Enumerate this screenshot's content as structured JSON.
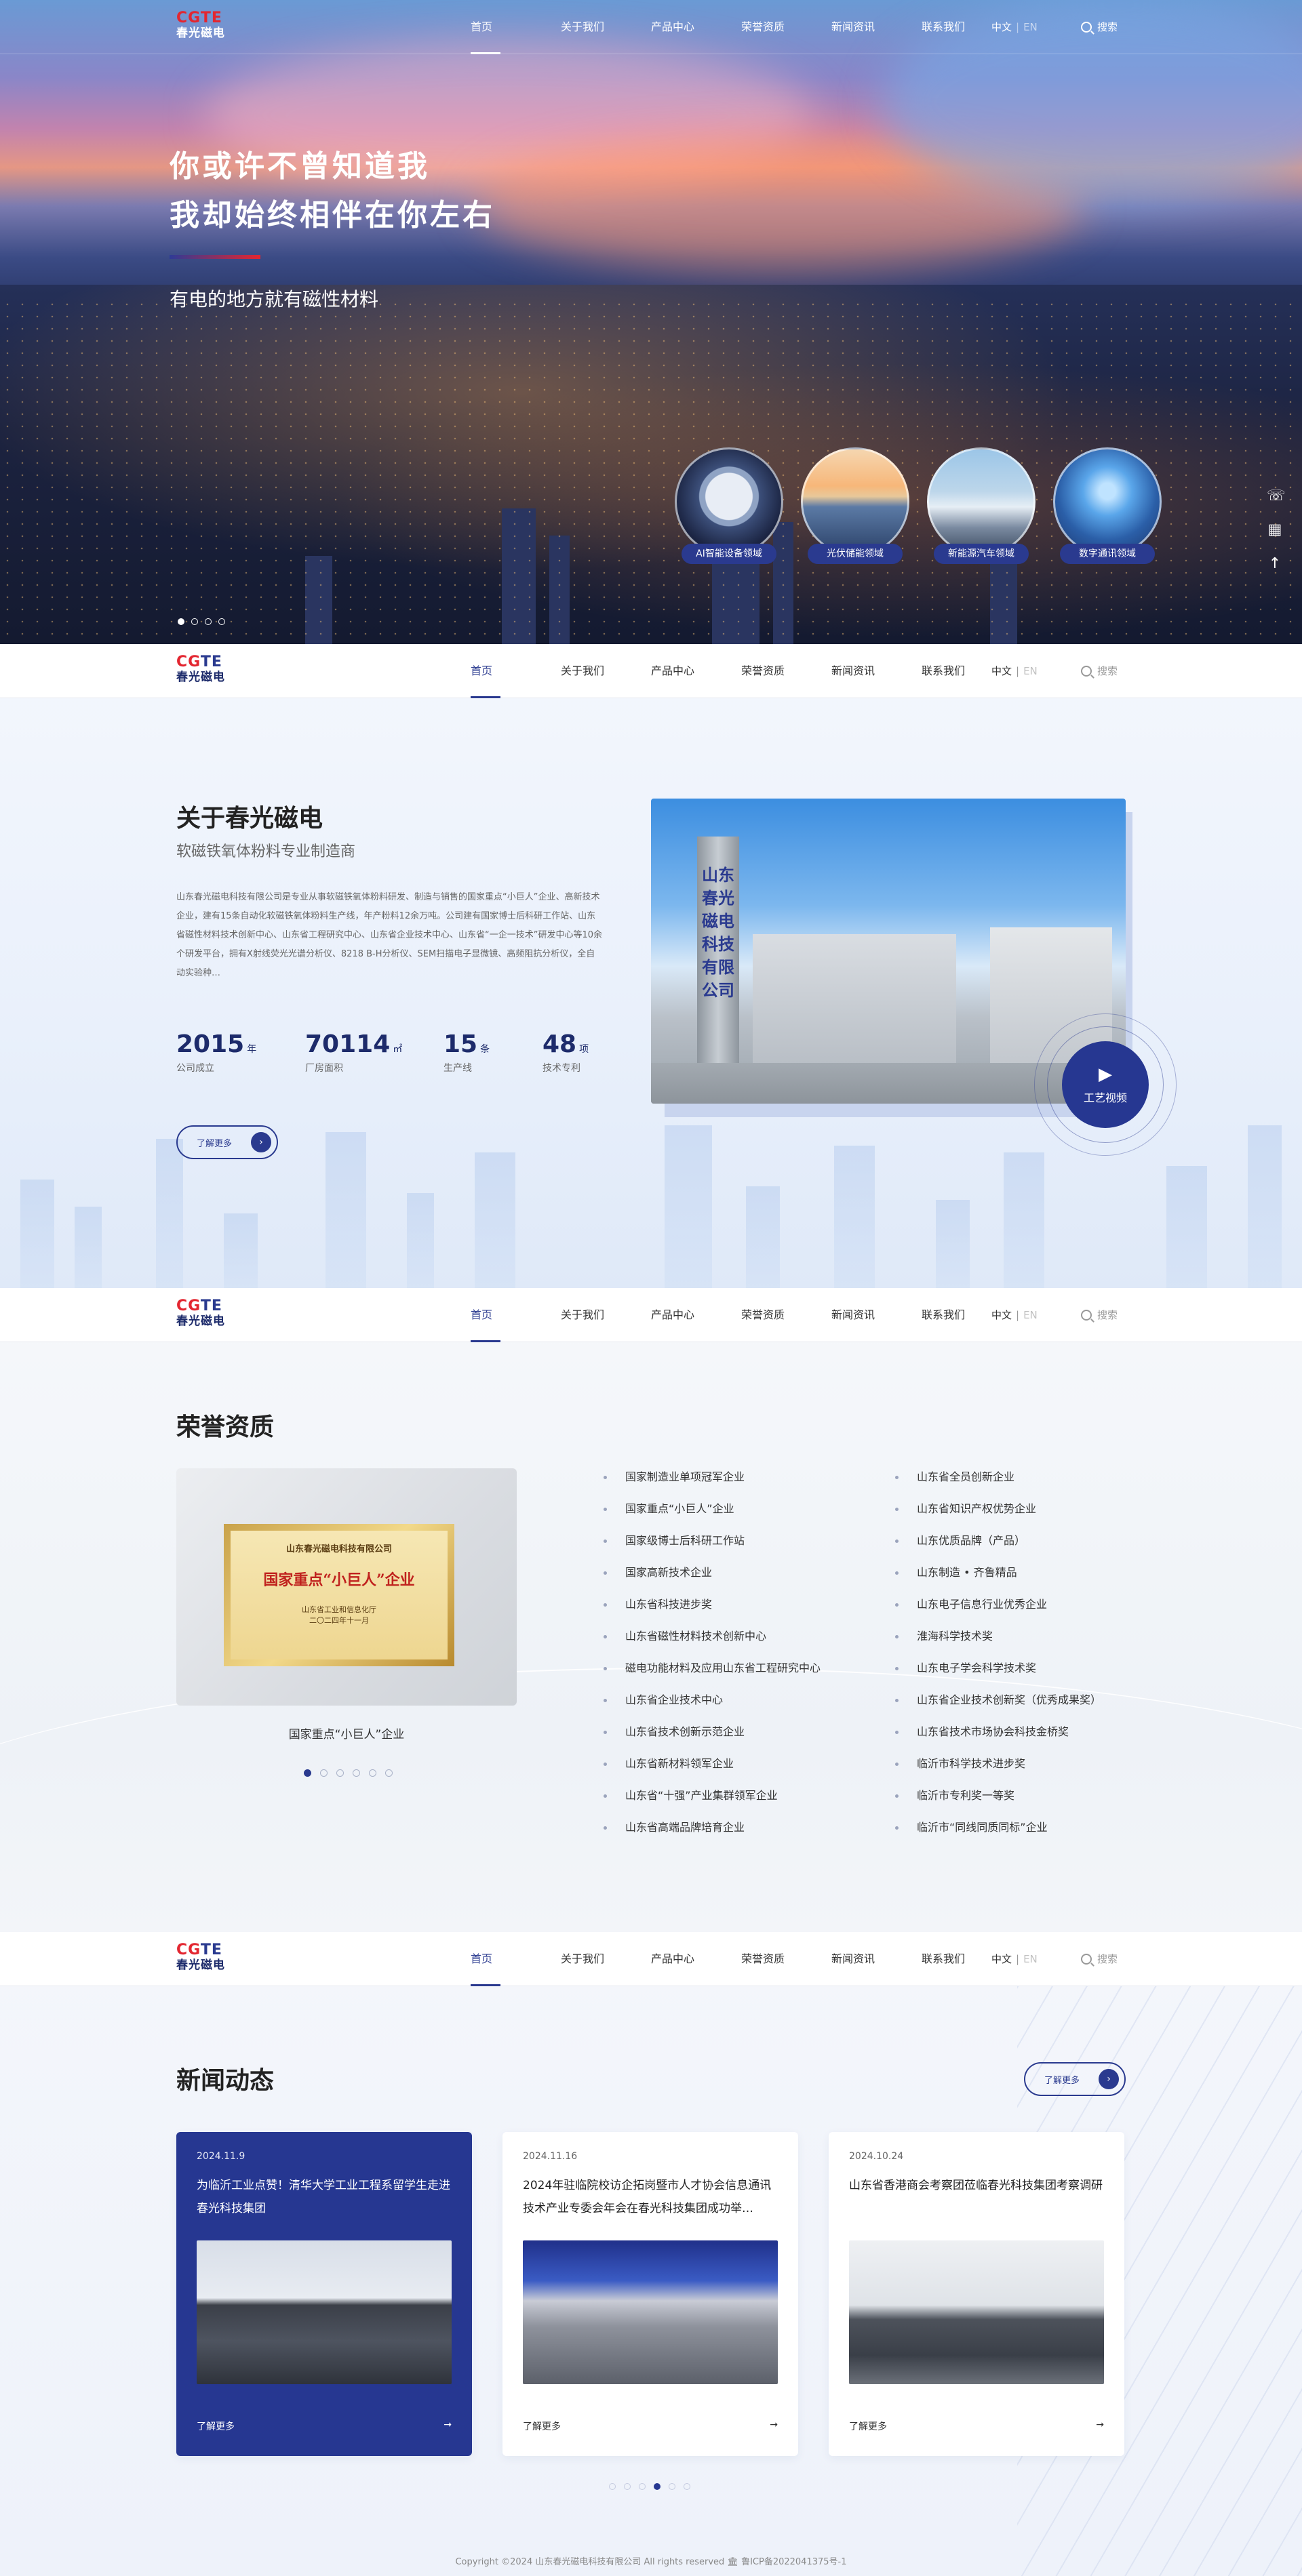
{
  "brand": {
    "logo_mark_a": "CG",
    "logo_mark_b": "TE",
    "logo_cn": "春光磁电"
  },
  "nav": {
    "items": [
      "首页",
      "关于我们",
      "产品中心",
      "荣誉资质",
      "新闻资讯",
      "联系我们"
    ],
    "lang_cn": "中文",
    "lang_sep": "|",
    "lang_en": "EN",
    "search_label": "搜索"
  },
  "hero": {
    "headline_1": "你或许不曾知道我",
    "headline_2": "我却始终相伴在你左右",
    "slogan": "有电的地方就有磁性材料",
    "fields": [
      "AI智能设备领域",
      "光伏储能领域",
      "新能源汽车领域",
      "数字通讯领域"
    ],
    "side_tools": {
      "phone_icon": "☏",
      "qrcode_icon": "▦",
      "top_icon": "↑"
    }
  },
  "about": {
    "title": "关于春光磁电",
    "subtitle": "软磁铁氧体粉料专业制造商",
    "description": "山东春光磁电科技有限公司是专业从事软磁铁氧体粉料研发、制造与销售的国家重点“小巨人”企业、高新技术企业，建有15条自动化软磁铁氧体粉料生产线，年产粉料12余万吨。公司建有国家博士后科研工作站、山东省磁性材料技术创新中心、山东省工程研究中心、山东省企业技术中心、山东省“一企一技术”研发中心等10余个研发平台，拥有X射线荧光光谱分析仪、8218 B-H分析仪、SEM扫描电子显微镜、高频阻抗分析仪，全自动实验种…",
    "stats": [
      {
        "num": "2015",
        "unit": "年",
        "label": "公司成立"
      },
      {
        "num": "70114",
        "unit": "㎡",
        "label": "厂房面积"
      },
      {
        "num": "15",
        "unit": "条",
        "label": "生产线"
      },
      {
        "num": "48",
        "unit": "项",
        "label": "技术专利"
      }
    ],
    "more_label": "了解更多",
    "pillar_text": "山东春光磁电科技有限公司",
    "video_label": "工艺视频"
  },
  "honors": {
    "title": "荣誉资质",
    "plaque": {
      "company": "山东春光磁电科技有限公司",
      "award": "国家重点“小巨人”企业",
      "issuer": "山东省工业和信息化厅",
      "date": "二〇二四年十一月"
    },
    "caption": "国家重点“小巨人”企业",
    "list_left": [
      "国家制造业单项冠军企业",
      "国家重点“小巨人”企业",
      "国家级博士后科研工作站",
      "国家高新技术企业",
      "山东省科技进步奖",
      "山东省磁性材料技术创新中心",
      "磁电功能材料及应用山东省工程研究中心",
      "山东省企业技术中心",
      "山东省技术创新示范企业",
      "山东省新材料领军企业",
      "山东省“十强”产业集群领军企业",
      "山东省高端品牌培育企业"
    ],
    "list_right": [
      "山东省全员创新企业",
      "山东省知识产权优势企业",
      "山东优质品牌（产品）",
      "山东制造 • 齐鲁精品",
      "山东电子信息行业优秀企业",
      "淮海科学技术奖",
      "山东电子学会科学技术奖",
      "山东省企业技术创新奖（优秀成果奖）",
      "山东省技术市场协会科技金桥奖",
      "临沂市科学技术进步奖",
      "临沂市专利奖一等奖",
      "临沂市“同线同质同标”企业"
    ]
  },
  "news": {
    "title": "新闻动态",
    "more_label": "了解更多",
    "cards": [
      {
        "date": "2024.11.9",
        "title": "为临沂工业点赞！清华大学工业工程系留学生走进春光科技集团",
        "more": "了解更多"
      },
      {
        "date": "2024.11.16",
        "title": "2024年驻临院校访企拓岗暨市人才协会信息通讯技术产业专委会年会在春光科技集团成功举…",
        "more": "了解更多"
      },
      {
        "date": "2024.10.24",
        "title": "山东省香港商会考察团莅临春光科技集团考察调研",
        "more": "了解更多"
      }
    ],
    "copyright": "Copyright ©2024 山东春光磁电科技有限公司 All rights reserved 🏛 鲁ICP备2022041375号-1"
  },
  "colors": {
    "brand_blue": "#263791",
    "brand_red": "#e32630"
  }
}
